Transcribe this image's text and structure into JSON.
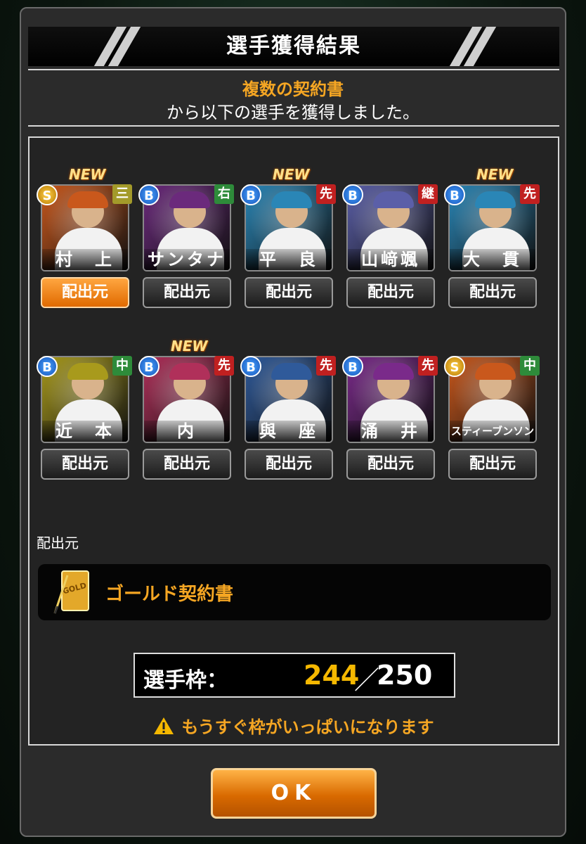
{
  "dialog": {
    "title": "選手獲得結果",
    "source_highlight": "複数の契約書",
    "message": "から以下の選手を獲得しました。"
  },
  "players": [
    {
      "name": "村　上",
      "rank": "S",
      "position": "三",
      "pos_color": "#a39a2a",
      "is_new": true,
      "button_label": "配出元",
      "button_active": true,
      "bg": "#c9581c"
    },
    {
      "name": "サンタナ",
      "rank": "B",
      "position": "右",
      "pos_color": "#2e8b3a",
      "is_new": false,
      "button_label": "配出元",
      "button_active": false,
      "bg": "#6b2a7c"
    },
    {
      "name": "平　良",
      "rank": "B",
      "position": "先",
      "pos_color": "#c02020",
      "is_new": true,
      "button_label": "配出元",
      "button_active": false,
      "bg": "#2a86b6"
    },
    {
      "name": "山﨑颯",
      "rank": "B",
      "position": "継",
      "pos_color": "#c02020",
      "is_new": false,
      "button_label": "配出元",
      "button_active": false,
      "bg": "#5b5fa8"
    },
    {
      "name": "大　貫",
      "rank": "B",
      "position": "先",
      "pos_color": "#c02020",
      "is_new": true,
      "button_label": "配出元",
      "button_active": false,
      "bg": "#2a86b6"
    },
    {
      "name": "近　本",
      "rank": "B",
      "position": "中",
      "pos_color": "#2e8b3a",
      "is_new": false,
      "button_label": "配出元",
      "button_active": false,
      "bg": "#a89a1c"
    },
    {
      "name": "内",
      "rank": "B",
      "position": "先",
      "pos_color": "#c02020",
      "is_new": true,
      "button_label": "配出元",
      "button_active": false,
      "bg": "#b0305a"
    },
    {
      "name": "與　座",
      "rank": "B",
      "position": "先",
      "pos_color": "#c02020",
      "is_new": false,
      "button_label": "配出元",
      "button_active": false,
      "bg": "#2f5a9a"
    },
    {
      "name": "涌　井",
      "rank": "B",
      "position": "先",
      "pos_color": "#c02020",
      "is_new": false,
      "button_label": "配出元",
      "button_active": false,
      "bg": "#7a2a8a"
    },
    {
      "name": "スティーブンソン",
      "rank": "S",
      "position": "中",
      "pos_color": "#2e8b3a",
      "is_new": false,
      "button_label": "配出元",
      "button_active": false,
      "bg": "#c9581c"
    }
  ],
  "new_label": "NEW",
  "source": {
    "label": "配出元",
    "item_name": "ゴールド契約書",
    "icon": "gold-contract-icon",
    "icon_text": "GOLD"
  },
  "capacity": {
    "label": "選手枠：",
    "current": "244",
    "separator": "／",
    "max": "250",
    "warning": "もうすぐ枠がいっぱいになります"
  },
  "ok_button": {
    "label": "OK"
  }
}
